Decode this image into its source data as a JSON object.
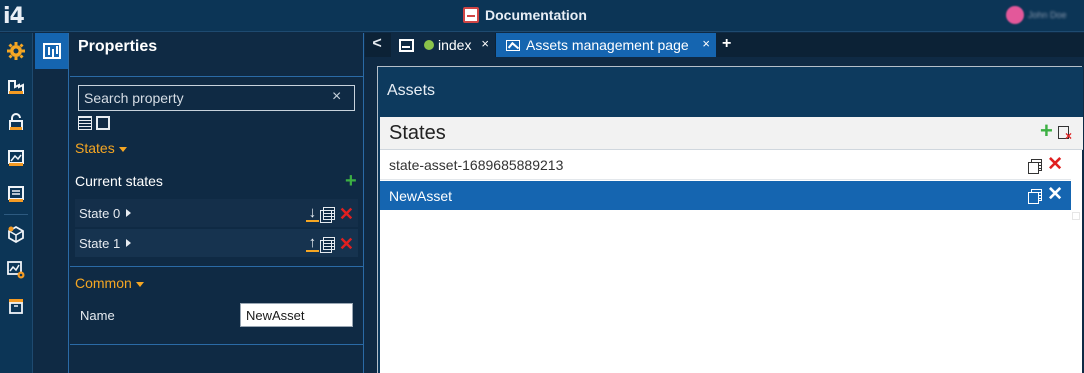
{
  "app": {
    "logo": "i4",
    "document_title": "Documentation",
    "user_name": "John Doe"
  },
  "rail": {
    "items": [
      "settings-gear-icon",
      "factory-icon",
      "lock-icon",
      "monitor-image-icon",
      "server-icon",
      "package-icon",
      "chart-gear-icon",
      "archive-icon"
    ]
  },
  "properties": {
    "title": "Properties",
    "search_placeholder": "Search property",
    "search_clear": "×",
    "states_section": "States",
    "current_states_label": "Current states",
    "states": [
      {
        "label": "State 0",
        "move_icon": "move-down-icon"
      },
      {
        "label": "State 1",
        "move_icon": "move-up-icon"
      }
    ],
    "common_section": "Common",
    "name_label": "Name",
    "name_value": "NewAsset"
  },
  "tabs": {
    "nav_back": "<",
    "items": [
      {
        "label": "index",
        "close": "×"
      },
      {
        "label": "Assets management page",
        "close": "×"
      }
    ],
    "add": "+"
  },
  "canvas": {
    "header_title": "Assets",
    "states_title": "States",
    "list": [
      {
        "label": "state-asset-1689685889213",
        "selected": false
      },
      {
        "label": "NewAsset",
        "selected": true
      }
    ]
  },
  "colors": {
    "accent_orange": "#f5a623",
    "selected_blue": "#1565b0",
    "add_green": "#3cb043",
    "delete_red": "#e02020",
    "dark_bg": "#0f2a44"
  }
}
